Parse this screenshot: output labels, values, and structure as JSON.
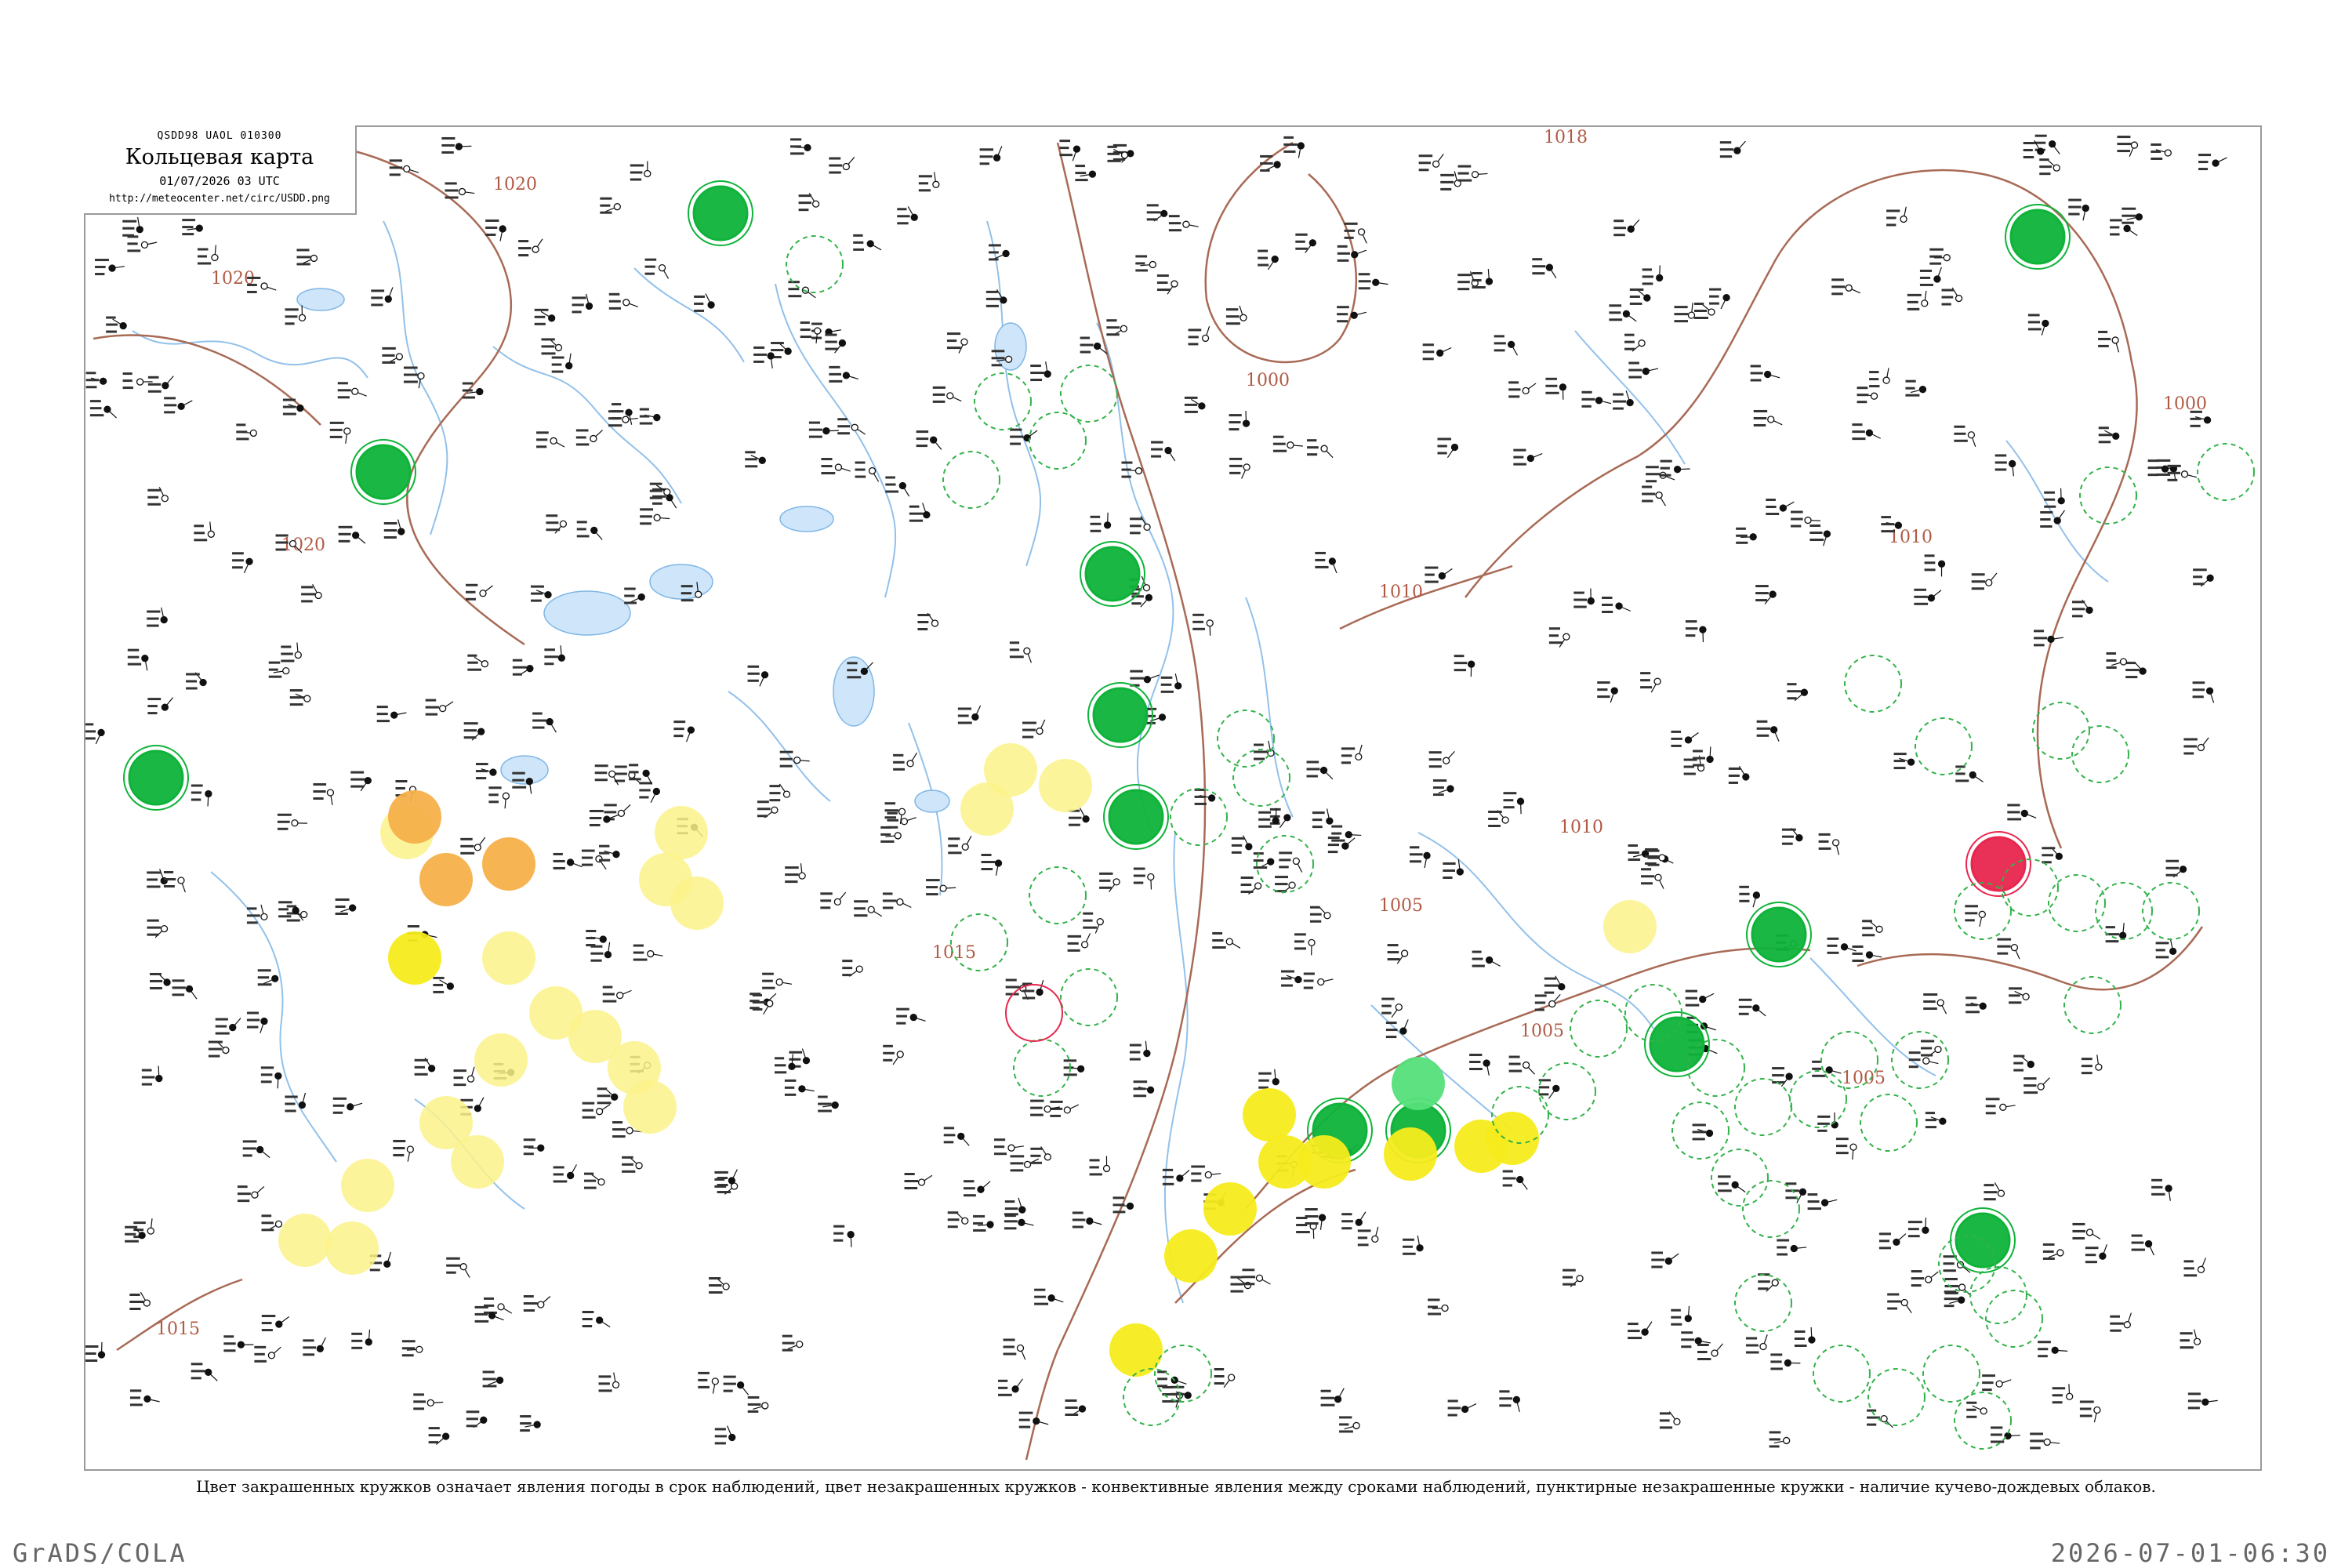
{
  "header": {
    "product_code": "QSDD98  UAOL  010300",
    "title": "Кольцевая карта",
    "datetime": "01/07/2026 03 UTC",
    "url": "http://meteocenter.net/circ/USDD.png"
  },
  "caption": "Цвет закрашенных кружков означает явления погоды в срок наблюдений, цвет незакрашенных кружков - конвективные явления между сроками наблюдений, пунктирные незакрашенные кружки - наличие кучево-дождевых облаков.",
  "footer": {
    "software": "GrADS/COLA",
    "timestamp": "2026-07-01-06:30"
  },
  "isobar_labels": [
    "1020",
    "1020",
    "1020",
    "1018",
    "1015",
    "1015",
    "1010",
    "1010",
    "1010",
    "1005",
    "1005",
    "1005",
    "1000",
    "1000"
  ],
  "colors": {
    "isobar": "#a86a55",
    "rivers": "#7fb6e6",
    "thunder_green": "#0fb33a",
    "light_green": "#55e07a",
    "yellow": "#f5ec1c",
    "light_yellow": "#fbf28a",
    "orange": "#f5b04a",
    "red": "#e8264e",
    "convective_outline": "#33b24a",
    "cb_dashed": "#33b24a"
  },
  "legend_note_icons": [
    "filled-circle-icon",
    "dashed-circle-icon"
  ]
}
